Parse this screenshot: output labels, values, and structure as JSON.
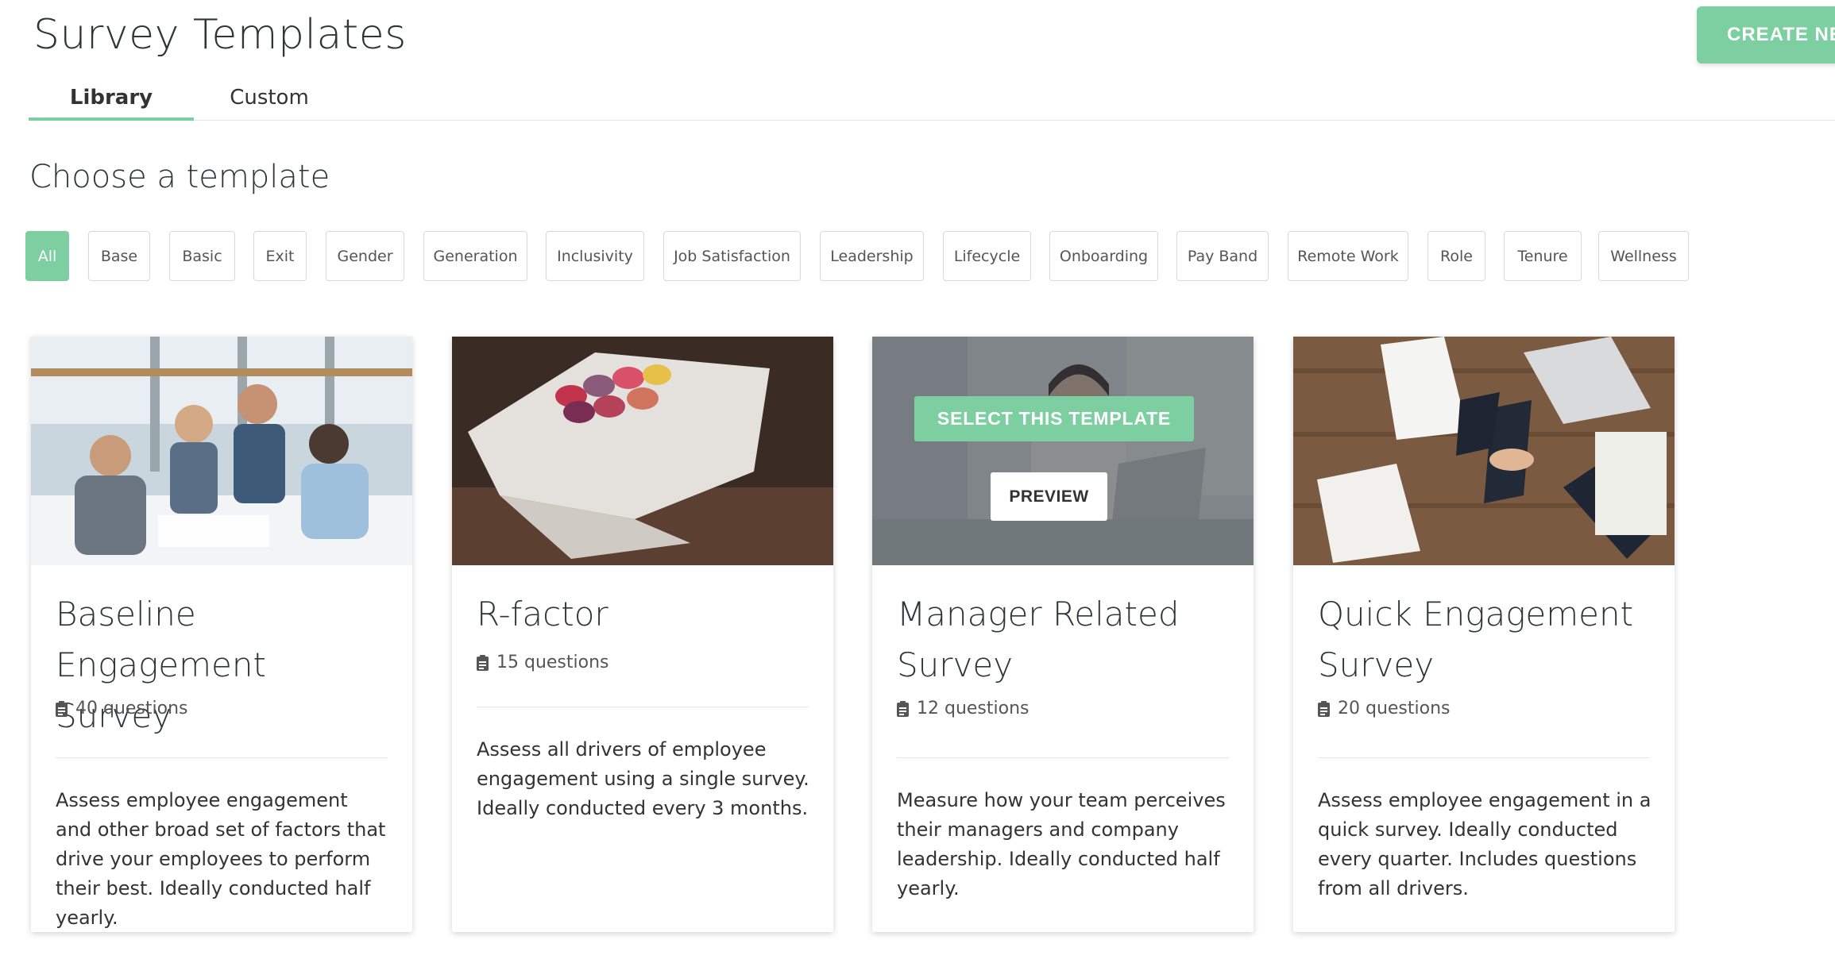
{
  "header": {
    "title": "Survey Templates",
    "create_button": "CREATE NEW"
  },
  "tabs": [
    {
      "label": "Library",
      "active": true
    },
    {
      "label": "Custom",
      "active": false
    }
  ],
  "section_title": "Choose a template",
  "filters": [
    {
      "label": "All",
      "active": true
    },
    {
      "label": "Base"
    },
    {
      "label": "Basic"
    },
    {
      "label": "Exit"
    },
    {
      "label": "Gender"
    },
    {
      "label": "Generation"
    },
    {
      "label": "Inclusivity"
    },
    {
      "label": "Job Satisfaction"
    },
    {
      "label": "Leadership"
    },
    {
      "label": "Lifecycle"
    },
    {
      "label": "Onboarding"
    },
    {
      "label": "Pay Band"
    },
    {
      "label": "Remote Work"
    },
    {
      "label": "Role"
    },
    {
      "label": "Tenure"
    },
    {
      "label": "Wellness"
    }
  ],
  "cards": [
    {
      "title": "Baseline Engagement Survey",
      "questions": "40 questions",
      "description": "Assess employee engagement and other broad set of factors that drive your employees to perform their best. Ideally conducted half yearly.",
      "image": "team-meeting-photo"
    },
    {
      "title": "R-factor",
      "questions": "15 questions",
      "description": "Assess all drivers of employee engagement using a single survey. Ideally conducted every 3 months.",
      "image": "macarons-photo"
    },
    {
      "title": "Manager Related Survey",
      "questions": "12 questions",
      "description": "Measure how your team perceives their managers and company leadership. Ideally conducted half yearly.",
      "image": "office-woman-photo",
      "hover": {
        "select_label": "SELECT THIS TEMPLATE",
        "preview_label": "PREVIEW"
      }
    },
    {
      "title": "Quick Engagement Survey",
      "questions": "20 questions",
      "description": "Assess employee engagement in a quick survey. Ideally conducted every quarter. Includes questions from all drivers.",
      "image": "handshake-desk-photo"
    }
  ],
  "colors": {
    "accent": "#7dcea0",
    "title_text": "#2f3439",
    "border": "#d6d9dc"
  },
  "icons": {
    "question_count": "clipboard-icon"
  }
}
